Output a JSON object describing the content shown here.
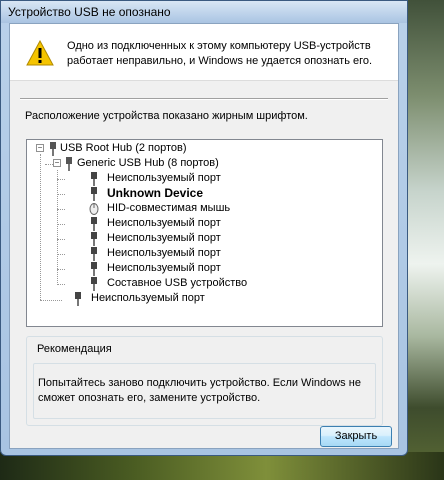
{
  "window": {
    "title": "Устройство USB не опознано"
  },
  "message": {
    "text": "Одно из подключенных к этому компьютеру USB-устройств работает неправильно, и Windows не удается опознать его.",
    "icon": "warning-icon"
  },
  "location_label": "Расположение устройства показано жирным шрифтом.",
  "tree": {
    "root": "USB Root Hub (2 портов)",
    "hub": "Generic USB Hub (8 портов)",
    "hub_ports": [
      "Неиспользуемый порт",
      "Unknown Device",
      "HID-совместимая мышь",
      "Неиспользуемый порт",
      "Неиспользуемый порт",
      "Неиспользуемый порт",
      "Неиспользуемый порт",
      "Составное USB устройство"
    ],
    "root_port": "Неиспользуемый порт"
  },
  "recommendation": {
    "title": "Рекомендация",
    "text": "Попытайтесь заново подключить устройство. Если Windows не сможет опознать его, замените устройство."
  },
  "buttons": {
    "close": "Закрыть"
  }
}
